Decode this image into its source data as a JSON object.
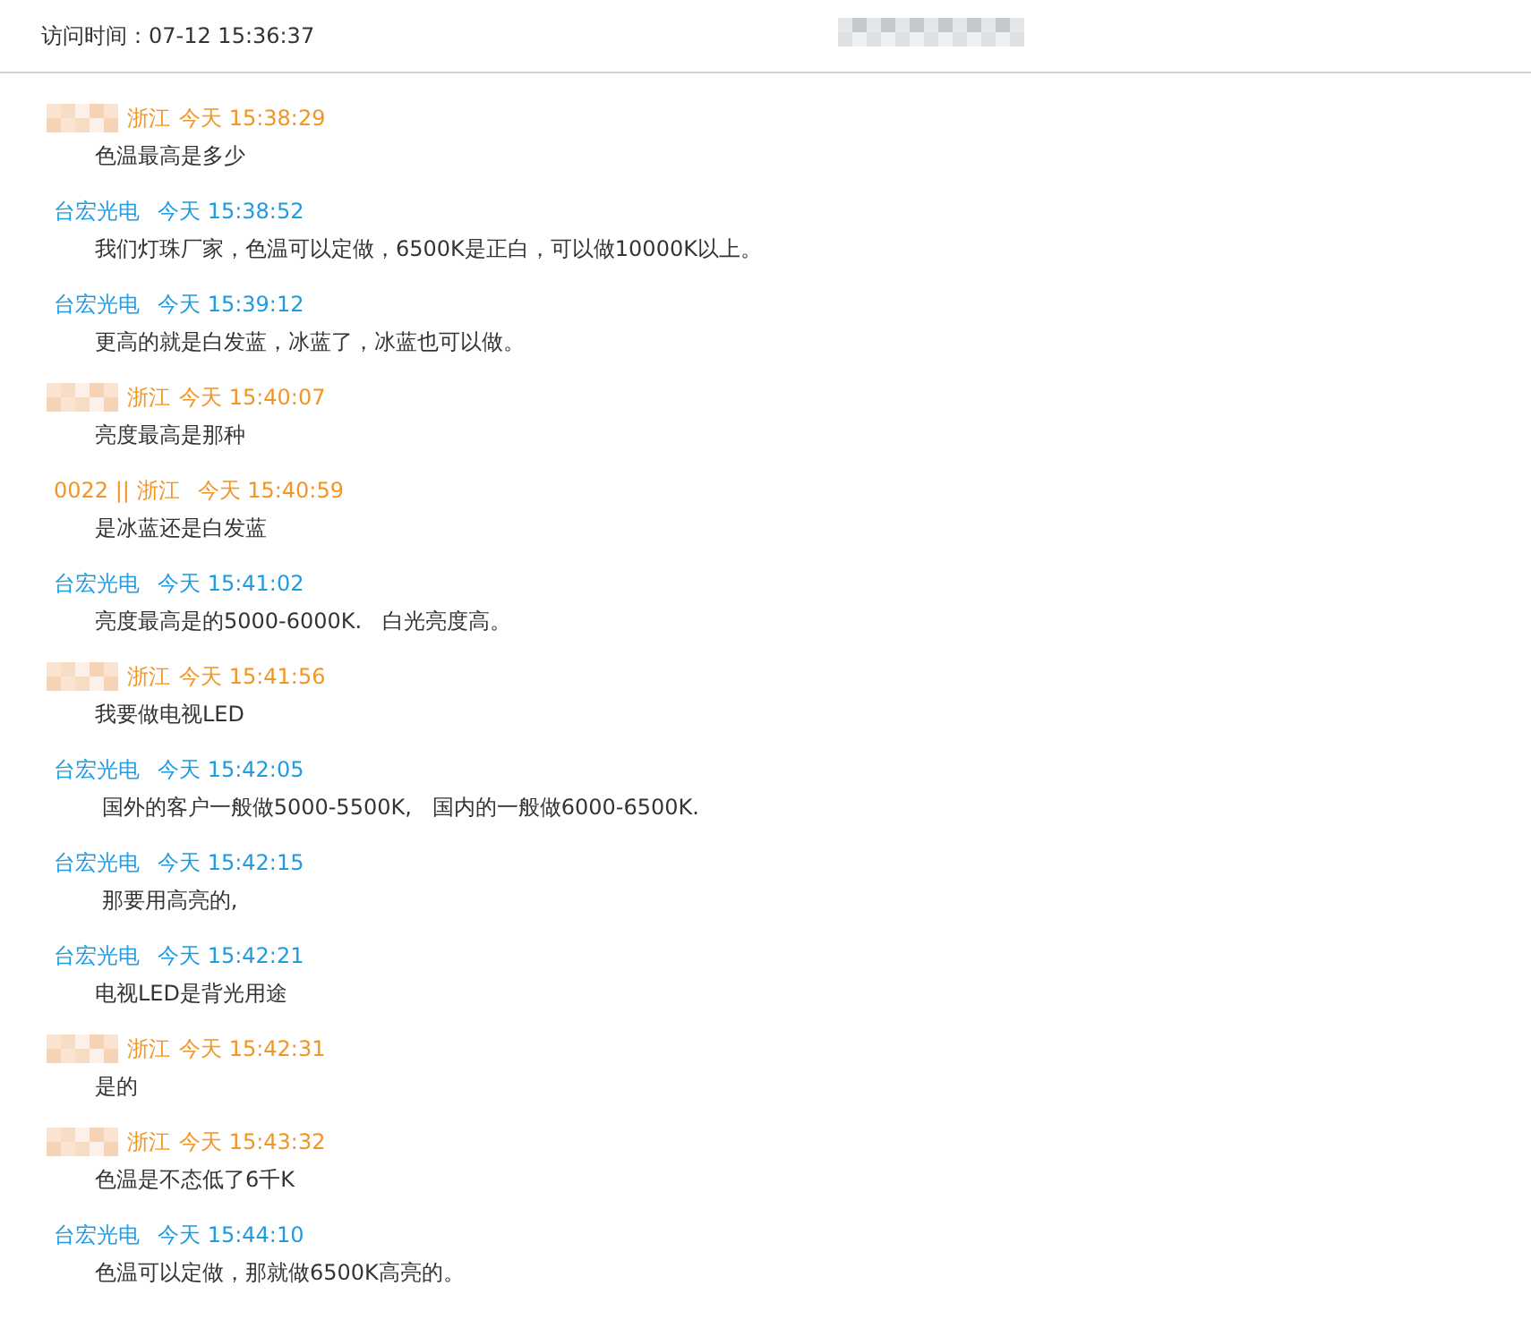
{
  "header": {
    "visit_label": "访问时间：",
    "visit_time": "07-12 15:36:37"
  },
  "messages": [
    {
      "kind": "visitor",
      "masked": true,
      "sender": "浙江",
      "time": "今天 15:38:29",
      "text": "色温最高是多少"
    },
    {
      "kind": "agent",
      "masked": false,
      "sender": "台宏光电",
      "time": "今天 15:38:52",
      "text": "我们灯珠厂家，色温可以定做，6500K是正白，可以做10000K以上。"
    },
    {
      "kind": "agent",
      "masked": false,
      "sender": "台宏光电",
      "time": "今天 15:39:12",
      "text": "更高的就是白发蓝，冰蓝了，冰蓝也可以做。"
    },
    {
      "kind": "visitor",
      "masked": true,
      "sender": "浙江",
      "time": "今天 15:40:07",
      "text": "亮度最高是那种"
    },
    {
      "kind": "visitor",
      "masked": false,
      "sender": "0022 || 浙江",
      "time": "今天 15:40:59",
      "text": "是冰蓝还是白发蓝"
    },
    {
      "kind": "agent",
      "masked": false,
      "sender": "台宏光电",
      "time": "今天 15:41:02",
      "text": "亮度最高是的5000-6000K.   白光亮度高。"
    },
    {
      "kind": "visitor",
      "masked": true,
      "sender": "浙江",
      "time": "今天 15:41:56",
      "text": "我要做电视LED"
    },
    {
      "kind": "agent",
      "masked": false,
      "sender": "台宏光电",
      "time": "今天 15:42:05",
      "text": " 国外的客户一般做5000-5500K,   国内的一般做6000-6500K."
    },
    {
      "kind": "agent",
      "masked": false,
      "sender": "台宏光电",
      "time": "今天 15:42:15",
      "text": " 那要用高亮的,"
    },
    {
      "kind": "agent",
      "masked": false,
      "sender": "台宏光电",
      "time": "今天 15:42:21",
      "text": "电视LED是背光用途"
    },
    {
      "kind": "visitor",
      "masked": true,
      "sender": "浙江",
      "time": "今天 15:42:31",
      "text": "是的"
    },
    {
      "kind": "visitor",
      "masked": true,
      "sender": "浙江",
      "time": "今天 15:43:32",
      "text": "色温是不态低了6千K"
    },
    {
      "kind": "agent",
      "masked": false,
      "sender": "台宏光电",
      "time": "今天 15:44:10",
      "text": "色温可以定做，那就做6500K高亮的。"
    }
  ]
}
